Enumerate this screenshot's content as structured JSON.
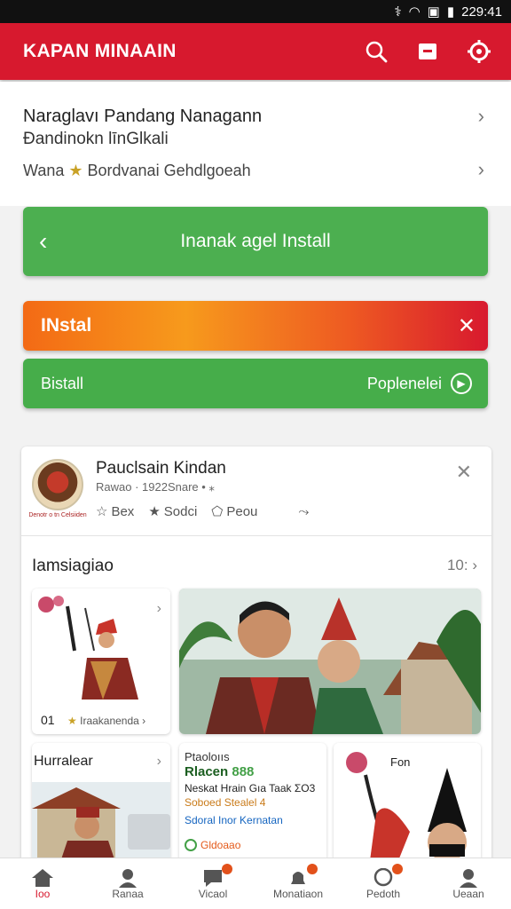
{
  "status_bar": {
    "time": "229:41"
  },
  "app_bar": {
    "title": "KAPAN MINAAIN",
    "brand_color": "#d7192e"
  },
  "info_card": {
    "title_line1": "Naraglavı Pandang Nanagann",
    "title_line2": "Đandinokn līnGlkali",
    "subtitle_prefix": "Wana",
    "subtitle_text": "Bordvanai Gehdlgoeah"
  },
  "buttons": {
    "green_main": "Inanak agel Install",
    "orange_install": "INstal",
    "green_left": "Bistall",
    "green_right": "Poplenelei"
  },
  "post": {
    "author": "Pauclsain Kindan",
    "meta": "Rawao · 1922Snare • ⁎",
    "avatar_caption": "Denotr o tn Celsiiden",
    "actions": [
      "Bex",
      "Sodci",
      "Peou"
    ]
  },
  "section": {
    "title": "Iamsiagiao",
    "count": "10:"
  },
  "tiles": {
    "tile1_count": "01",
    "tile1_label": "Iraakanenda",
    "tile3_title": "Hurralear",
    "tile4_line1": "Ptaoloııs",
    "tile4_line2": "Rlacen",
    "tile4_line2b": "888",
    "tile4_line3": "Neskat Hrain Gıa Taak ΣO3",
    "tile4_line4": "Soboed Stealel 4",
    "tile4_line5": "Sdoral Inor Kernatan",
    "tile4_tag": "Gldoaao",
    "tile5_label": "Fon"
  },
  "bottom_nav": [
    "Ioo",
    "Ranaa",
    "Vicaol",
    "Monatiaon",
    "Pedoth",
    "Ueaan"
  ]
}
